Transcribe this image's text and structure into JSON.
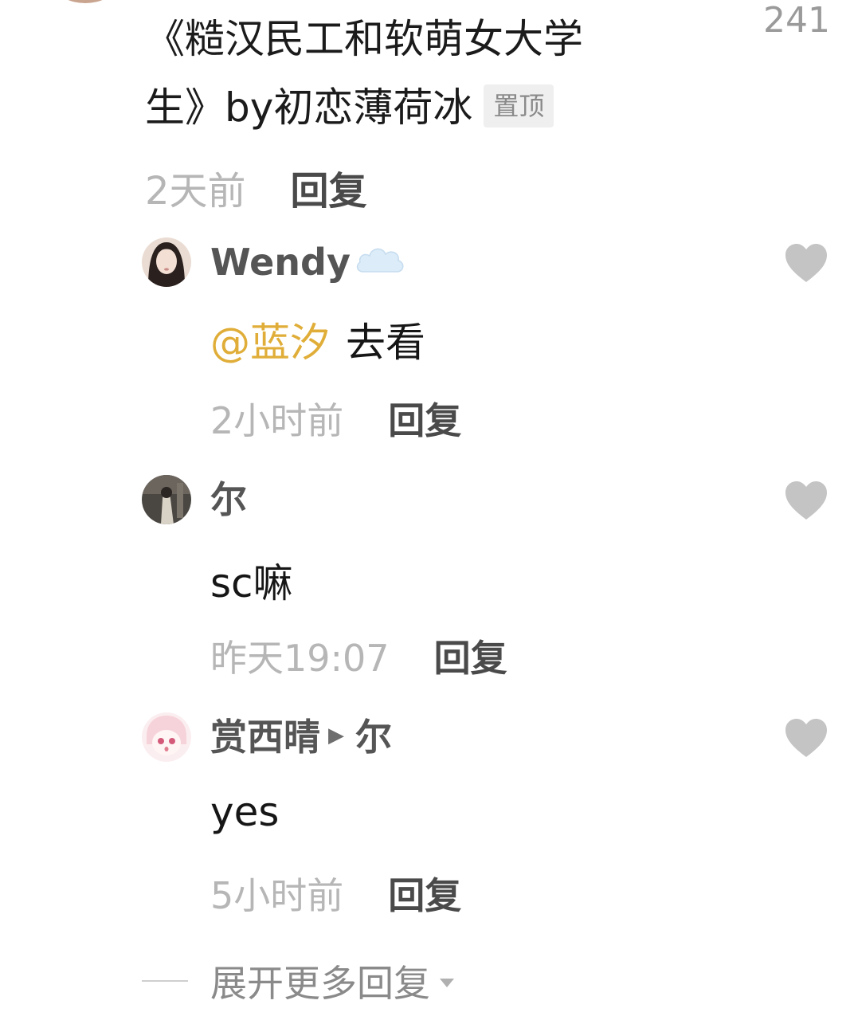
{
  "comment": {
    "text_line1": "《糙汉民工和软萌女大学",
    "text_line2": "生》by初恋薄荷冰",
    "pin_badge": "置顶",
    "like_count": "241",
    "time": "2天前",
    "reply_label": "回复"
  },
  "replies": [
    {
      "name": "Wendy",
      "mention": "@蓝汐",
      "text": "去看",
      "time": "2小时前",
      "reply_label": "回复"
    },
    {
      "name": "尔",
      "text": "sc嘛",
      "time": "昨天19:07",
      "reply_label": "回复"
    },
    {
      "name": "赏西晴",
      "reply_to": "尔",
      "text": "yes",
      "time": "5小时前",
      "reply_label": "回复"
    }
  ],
  "expand": {
    "label": "展开更多回复"
  },
  "icons": {
    "heart": "heart-icon",
    "cloud": "cloud-icon",
    "chevron": "chevron-down-icon",
    "arrow": "triangle-right-icon"
  },
  "colors": {
    "mention": "#e0ae38",
    "heart": "#c4c4c4",
    "muted": "#b6b6b6"
  }
}
